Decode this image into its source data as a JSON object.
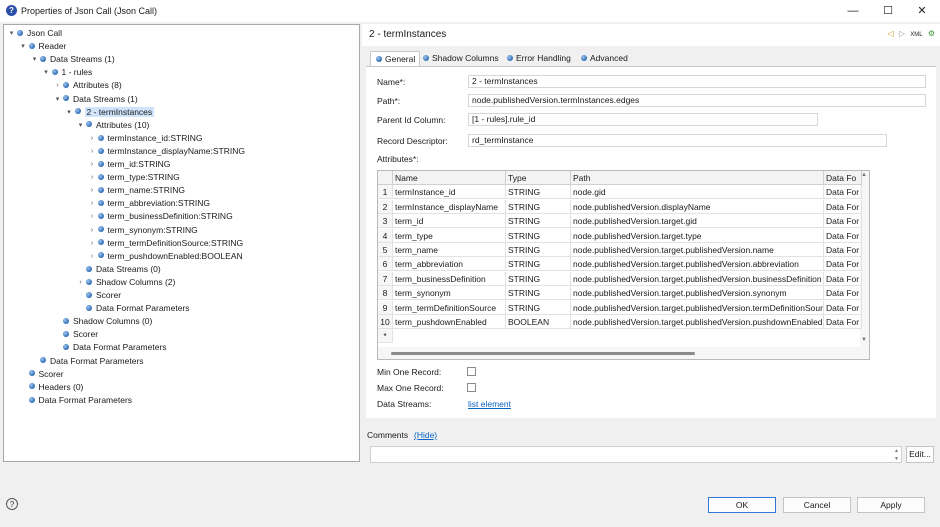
{
  "window": {
    "title": "Properties of Json Call (Json Call)",
    "minimize_glyph": "—",
    "maximize_glyph": "☐",
    "close_glyph": "✕"
  },
  "tree": [
    {
      "label": "Json Call",
      "toggle": "▾"
    },
    {
      "label": "Reader",
      "toggle": "▾"
    },
    {
      "label": "Data Streams (1)",
      "toggle": "▾"
    },
    {
      "label": "1 - rules",
      "toggle": "▾"
    },
    {
      "label": "Attributes (8)",
      "toggle": "›"
    },
    {
      "label": "Data Streams (1)",
      "toggle": "▾"
    },
    {
      "label": "2 - termInstances",
      "toggle": "▾",
      "selected": true
    },
    {
      "label": "Attributes (10)",
      "toggle": "▾"
    },
    {
      "label": "termInstance_id:STRING",
      "toggle": "›"
    },
    {
      "label": "termInstance_displayName:STRING",
      "toggle": "›"
    },
    {
      "label": "term_id:STRING",
      "toggle": "›"
    },
    {
      "label": "term_type:STRING",
      "toggle": "›"
    },
    {
      "label": "term_name:STRING",
      "toggle": "›"
    },
    {
      "label": "term_abbreviation:STRING",
      "toggle": "›"
    },
    {
      "label": "term_businessDefinition:STRING",
      "toggle": "›"
    },
    {
      "label": "term_synonym:STRING",
      "toggle": "›"
    },
    {
      "label": "term_termDefinitionSource:STRING",
      "toggle": "›"
    },
    {
      "label": "term_pushdownEnabled:BOOLEAN",
      "toggle": "›"
    },
    {
      "label": "Data Streams (0)",
      "toggle": ""
    },
    {
      "label": "Shadow Columns (2)",
      "toggle": "›"
    },
    {
      "label": "Scorer",
      "toggle": ""
    },
    {
      "label": "Data Format Parameters",
      "toggle": ""
    },
    {
      "label": "Shadow Columns (0)",
      "toggle": ""
    },
    {
      "label": "Scorer",
      "toggle": ""
    },
    {
      "label": "Data Format Parameters",
      "toggle": ""
    },
    {
      "label": "Data Format Parameters",
      "toggle": ""
    },
    {
      "label": "Scorer",
      "toggle": ""
    },
    {
      "label": "Headers (0)",
      "toggle": ""
    },
    {
      "label": "Data Format Parameters",
      "toggle": ""
    }
  ],
  "panel": {
    "title": "2 - termInstances",
    "icons": [
      "◁",
      "▷",
      "XML",
      "⚙"
    ]
  },
  "tabs": [
    "General",
    "Shadow Columns",
    "Error Handling",
    "Advanced"
  ],
  "form": {
    "name_label": "Name*:",
    "name_value": "2 - termInstances",
    "path_label": "Path*:",
    "path_value": "node.publishedVersion.termInstances.edges",
    "parent_label": "Parent Id Column:",
    "parent_value": "[1 - rules].rule_id",
    "descriptor_label": "Record Descriptor:",
    "descriptor_value": "rd_termInstance",
    "attributes_label": "Attributes*:",
    "min_label": "Min One Record:",
    "max_label": "Max One Record:",
    "streams_label": "Data Streams:",
    "streams_link": "list element"
  },
  "grid": {
    "headers": [
      "Name",
      "Type",
      "Path",
      "Data Fo"
    ],
    "rows": [
      {
        "n": "1",
        "name": "termInstance_id",
        "type": "STRING",
        "path": "node.gid",
        "fmt": "Data For"
      },
      {
        "n": "2",
        "name": "termInstance_displayName",
        "type": "STRING",
        "path": "node.publishedVersion.displayName",
        "fmt": "Data For"
      },
      {
        "n": "3",
        "name": "term_id",
        "type": "STRING",
        "path": "node.publishedVersion.target.gid",
        "fmt": "Data For"
      },
      {
        "n": "4",
        "name": "term_type",
        "type": "STRING",
        "path": "node.publishedVersion.target.type",
        "fmt": "Data For"
      },
      {
        "n": "5",
        "name": "term_name",
        "type": "STRING",
        "path": "node.publishedVersion.target.publishedVersion.name",
        "fmt": "Data For"
      },
      {
        "n": "6",
        "name": "term_abbreviation",
        "type": "STRING",
        "path": "node.publishedVersion.target.publishedVersion.abbreviation",
        "fmt": "Data For"
      },
      {
        "n": "7",
        "name": "term_businessDefinition",
        "type": "STRING",
        "path": "node.publishedVersion.target.publishedVersion.businessDefinition",
        "fmt": "Data For"
      },
      {
        "n": "8",
        "name": "term_synonym",
        "type": "STRING",
        "path": "node.publishedVersion.target.publishedVersion.synonym",
        "fmt": "Data For"
      },
      {
        "n": "9",
        "name": "term_termDefinitionSource",
        "type": "STRING",
        "path": "node.publishedVersion.target.publishedVersion.termDefinitionSource",
        "fmt": "Data For"
      },
      {
        "n": "10",
        "name": "term_pushdownEnabled",
        "type": "BOOLEAN",
        "path": "node.publishedVersion.target.publishedVersion.pushdownEnabled",
        "fmt": "Data For"
      }
    ],
    "new_row_marker": "*"
  },
  "comments": {
    "label": "Comments",
    "hide_link": "(Hide)",
    "edit_button": "Edit..."
  },
  "footer": {
    "help_glyph": "?",
    "ok": "OK",
    "cancel": "Cancel",
    "apply": "Apply"
  },
  "colors": {
    "accent": "#2f7ad7",
    "link": "#0b63c4",
    "selection": "#cfe3fa"
  }
}
